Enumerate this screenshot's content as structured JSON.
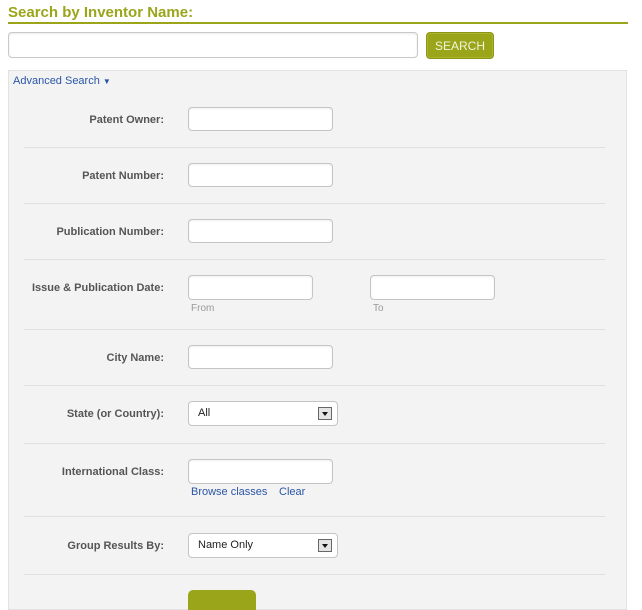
{
  "header": {
    "title": "Search by Inventor Name:"
  },
  "search": {
    "value": "",
    "placeholder": "",
    "button_label": "SEARCH"
  },
  "advanced": {
    "toggle_label": "Advanced Search",
    "toggle_icon": "triangle-down-icon",
    "arrow": "▼",
    "fields": {
      "patent_owner": {
        "label": "Patent Owner:",
        "value": ""
      },
      "patent_number": {
        "label": "Patent Number:",
        "value": ""
      },
      "publication_number": {
        "label": "Publication Number:",
        "value": ""
      },
      "issue_date": {
        "label": "Issue & Publication Date:",
        "from_value": "",
        "from_hint": "From",
        "to_value": "",
        "to_hint": "To"
      },
      "city_name": {
        "label": "City Name:",
        "value": ""
      },
      "state": {
        "label": "State (or Country):",
        "selected": "All"
      },
      "international_class": {
        "label": "International Class:",
        "value": "",
        "browse_link": "Browse classes",
        "clear_link": "Clear"
      },
      "group_results": {
        "label": "Group Results By:",
        "selected": "Name Only"
      }
    }
  },
  "colors": {
    "accent": "#9aa51a",
    "link": "#2a56a6",
    "panel_bg": "#f3f3f3"
  }
}
